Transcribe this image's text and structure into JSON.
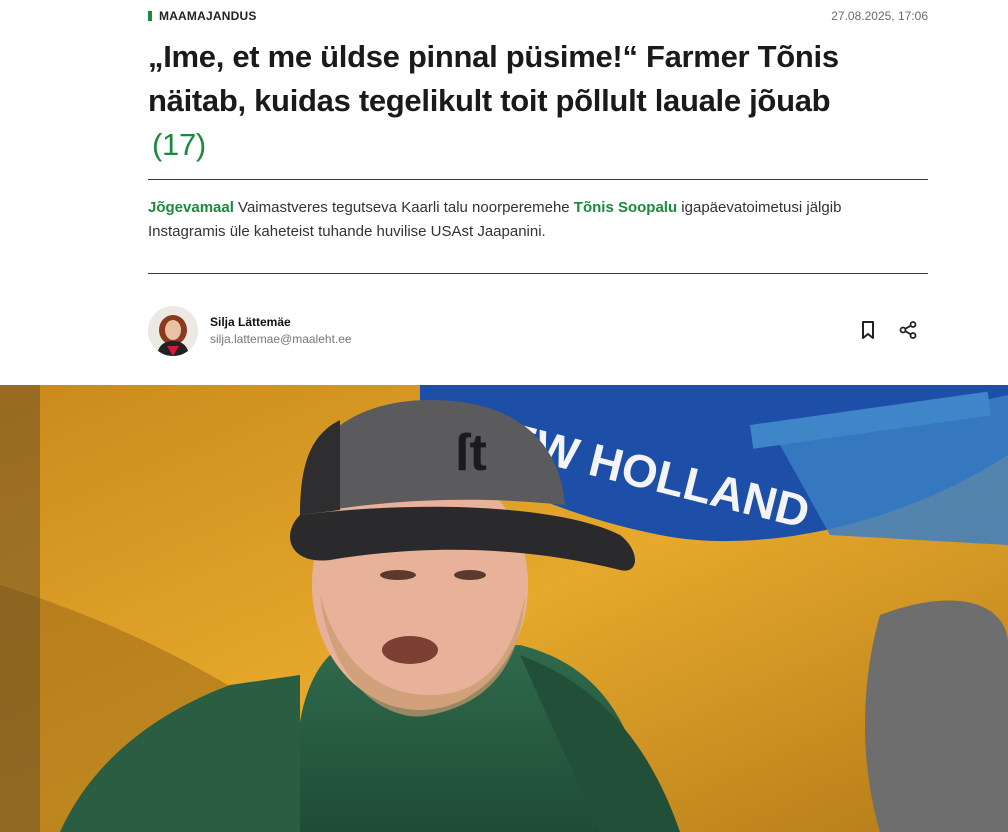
{
  "article": {
    "section": "MAAMAJANDUS",
    "date": "27.08.2025, 17:06",
    "headline": "„Ime, et me üldse pinnal püsime!“ Farmer Tõnis näitab, kuidas tegelikult toit põllult lauale jõuab",
    "comment_count": "(17)",
    "lead": {
      "link_place": "Jõgevamaal",
      "text_1": " Vaimastveres tegutseva Kaarli talu noorperemehe ",
      "link_person": "Tõnis Soopalu",
      "text_2": " igapäevatoimetusi jälgib Instagramis üle kaheteist tuhande huvilise USAst Jaapanini."
    }
  },
  "author": {
    "name": "Silja Lättemäe",
    "email": "silja.lattemae@maaleht.ee"
  },
  "hero_image": {
    "brand_text": "NEW HOLLAND"
  },
  "colors": {
    "accent": "#1a8a3c",
    "tractor_yellow": "#e3a62a",
    "brand_blue": "#1d4fa8"
  },
  "icons": {
    "bookmark": "bookmark-icon",
    "share": "share-icon"
  }
}
